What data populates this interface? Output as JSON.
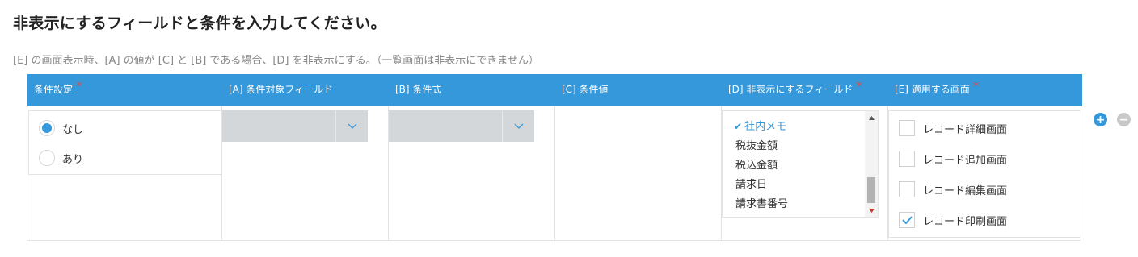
{
  "page": {
    "title": "非表示にするフィールドと条件を入力してください。",
    "description": "[E] の画面表示時、[A] の値が [C] と [B] である場合、[D] を非表示にする。（一覧画面は非表示にできません）"
  },
  "table": {
    "headers": [
      {
        "label": "条件設定",
        "required": true
      },
      {
        "label": "[A] 条件対象フィールド",
        "required": false
      },
      {
        "label": "[B] 条件式",
        "required": false
      },
      {
        "label": "[C] 条件値",
        "required": false
      },
      {
        "label": "[D] 非表示にするフィールド",
        "required": true
      },
      {
        "label": "[E] 適用する画面",
        "required": true
      }
    ],
    "required_mark": "*"
  },
  "condition_setting": {
    "options": [
      {
        "label": "なし",
        "checked": true
      },
      {
        "label": "あり",
        "checked": false
      }
    ]
  },
  "condition_field": {
    "value": ""
  },
  "condition_expression": {
    "value": ""
  },
  "hide_fields": {
    "check_mark": "✔",
    "items": [
      {
        "label": "社内メモ",
        "selected": true
      },
      {
        "label": "税抜金額",
        "selected": false
      },
      {
        "label": "税込金額",
        "selected": false
      },
      {
        "label": "請求日",
        "selected": false
      },
      {
        "label": "請求書番号",
        "selected": false
      }
    ]
  },
  "apply_screens": {
    "items": [
      {
        "label": "レコード詳細画面",
        "checked": false
      },
      {
        "label": "レコード追加画面",
        "checked": false
      },
      {
        "label": "レコード編集画面",
        "checked": false
      },
      {
        "label": "レコード印刷画面",
        "checked": true
      }
    ]
  },
  "row_actions": {
    "add": "+",
    "remove": "−"
  },
  "colors": {
    "header_bg": "#3498db",
    "accent": "#3498db",
    "required": "#e74c3c",
    "dropdown_bg": "#d4d7d9"
  }
}
